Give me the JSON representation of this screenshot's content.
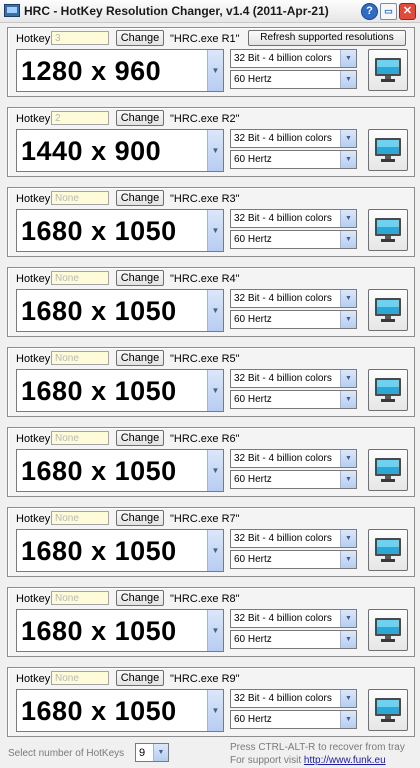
{
  "window": {
    "title": "HRC - HotKey Resolution Changer, v1.4 (2011-Apr-21)",
    "help_glyph": "?",
    "tray_glyph": "▭",
    "close_glyph": "✕"
  },
  "labels": {
    "hotkey": "Hotkey",
    "change": "Change",
    "refresh": "Refresh supported resolutions",
    "arrow": "▼"
  },
  "presets": [
    {
      "hotkey": "3",
      "hrc": "\"HRC.exe R1\"",
      "resolution": "1280 x 960",
      "color": "32 Bit - 4 billion colors",
      "freq": "60 Hertz"
    },
    {
      "hotkey": "2",
      "hrc": "\"HRC.exe R2\"",
      "resolution": "1440 x 900",
      "color": "32 Bit - 4 billion colors",
      "freq": "60 Hertz"
    },
    {
      "hotkey": "None",
      "hrc": "\"HRC.exe R3\"",
      "resolution": "1680 x 1050",
      "color": "32 Bit - 4 billion colors",
      "freq": "60 Hertz"
    },
    {
      "hotkey": "None",
      "hrc": "\"HRC.exe R4\"",
      "resolution": "1680 x 1050",
      "color": "32 Bit - 4 billion colors",
      "freq": "60 Hertz"
    },
    {
      "hotkey": "None",
      "hrc": "\"HRC.exe R5\"",
      "resolution": "1680 x 1050",
      "color": "32 Bit - 4 billion colors",
      "freq": "60 Hertz"
    },
    {
      "hotkey": "None",
      "hrc": "\"HRC.exe R6\"",
      "resolution": "1680 x 1050",
      "color": "32 Bit - 4 billion colors",
      "freq": "60 Hertz"
    },
    {
      "hotkey": "None",
      "hrc": "\"HRC.exe R7\"",
      "resolution": "1680 x 1050",
      "color": "32 Bit - 4 billion colors",
      "freq": "60 Hertz"
    },
    {
      "hotkey": "None",
      "hrc": "\"HRC.exe R8\"",
      "resolution": "1680 x 1050",
      "color": "32 Bit - 4 billion colors",
      "freq": "60 Hertz"
    },
    {
      "hotkey": "None",
      "hrc": "\"HRC.exe R9\"",
      "resolution": "1680 x 1050",
      "color": "32 Bit - 4 billion colors",
      "freq": "60 Hertz"
    }
  ],
  "footer": {
    "select_label": "Select number of HotKeys",
    "hotkey_count": "9",
    "recover_hint": "Press  CTRL-ALT-R to recover from tray",
    "support_prefix": "For support visit ",
    "support_link": "http://www.funk.eu"
  }
}
